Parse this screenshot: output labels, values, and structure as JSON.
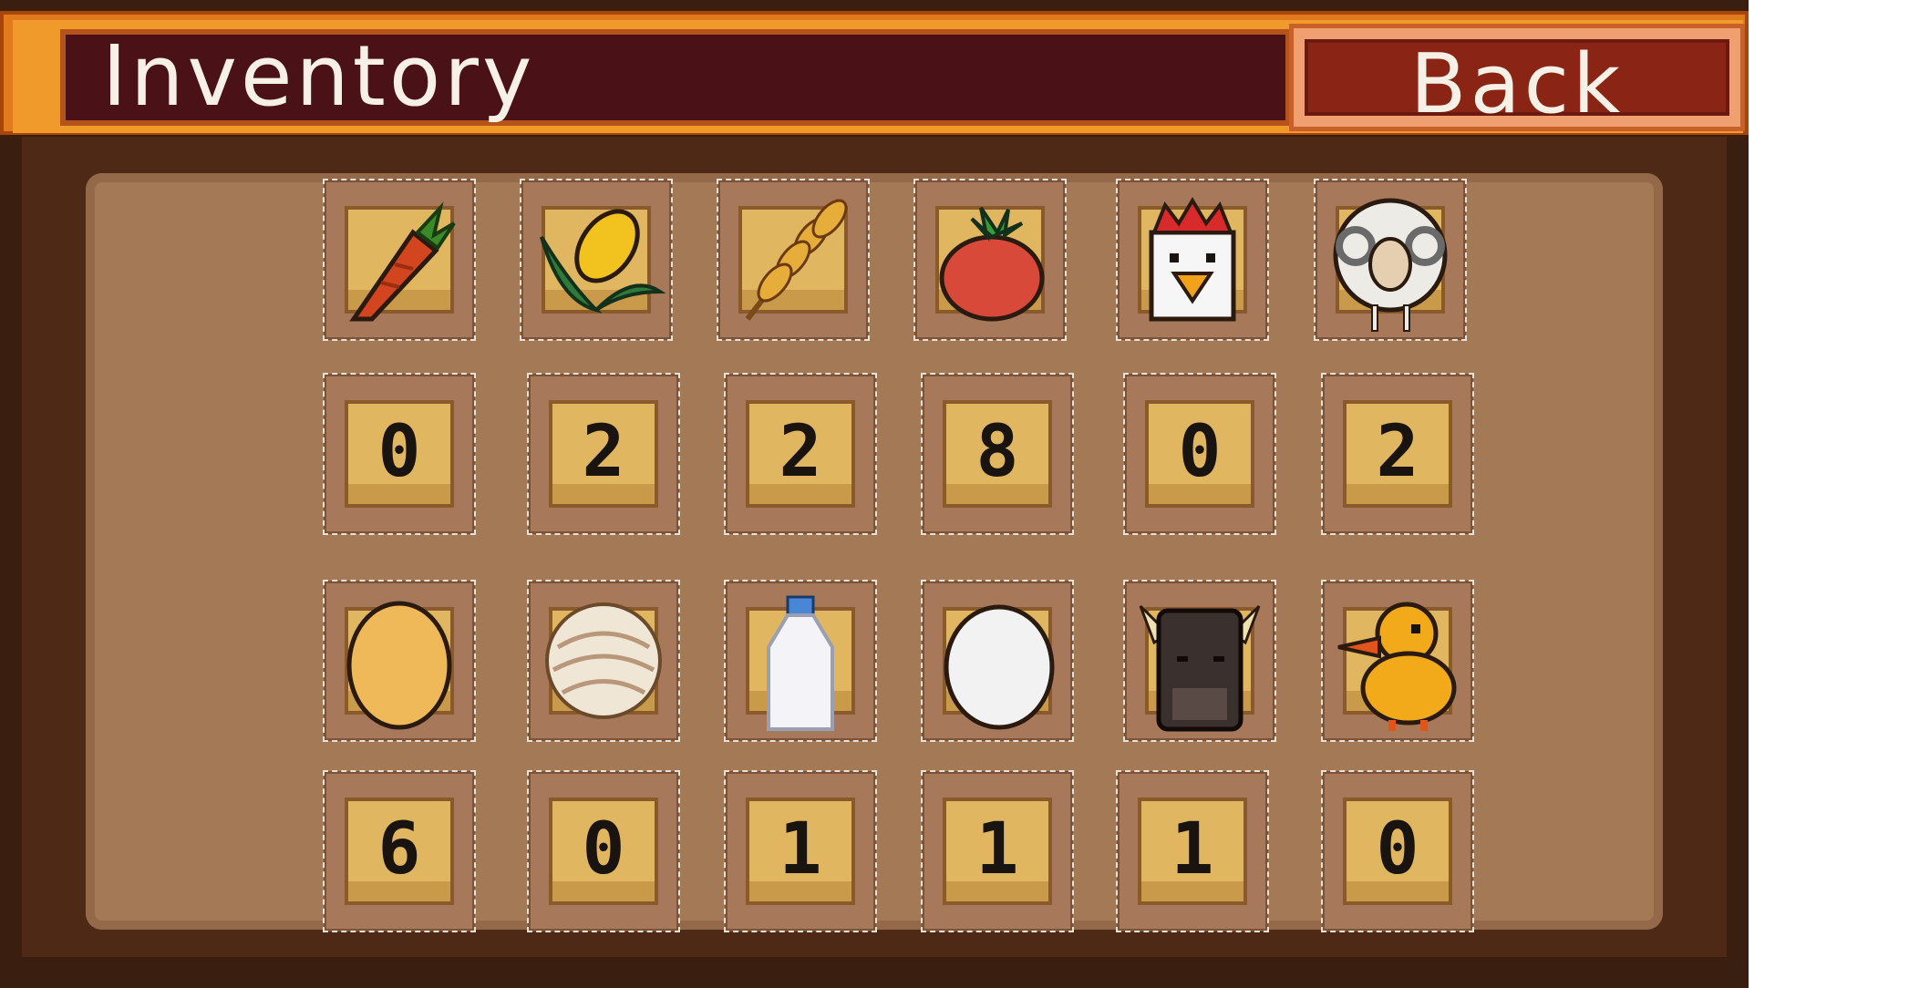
{
  "header": {
    "title": "Inventory",
    "back_label": "Back"
  },
  "inventory": [
    {
      "item": "carrot-icon",
      "count": "0"
    },
    {
      "item": "corn-icon",
      "count": "2"
    },
    {
      "item": "wheat-icon",
      "count": "2"
    },
    {
      "item": "tomato-icon",
      "count": "8"
    },
    {
      "item": "chicken-icon",
      "count": "0"
    },
    {
      "item": "sheep-icon",
      "count": "2"
    },
    {
      "item": "brown-egg-icon",
      "count": "6"
    },
    {
      "item": "wool-icon",
      "count": "0"
    },
    {
      "item": "milk-icon",
      "count": "1"
    },
    {
      "item": "white-egg-icon",
      "count": "1"
    },
    {
      "item": "cow-icon",
      "count": "1"
    },
    {
      "item": "duck-icon",
      "count": "0"
    }
  ]
}
